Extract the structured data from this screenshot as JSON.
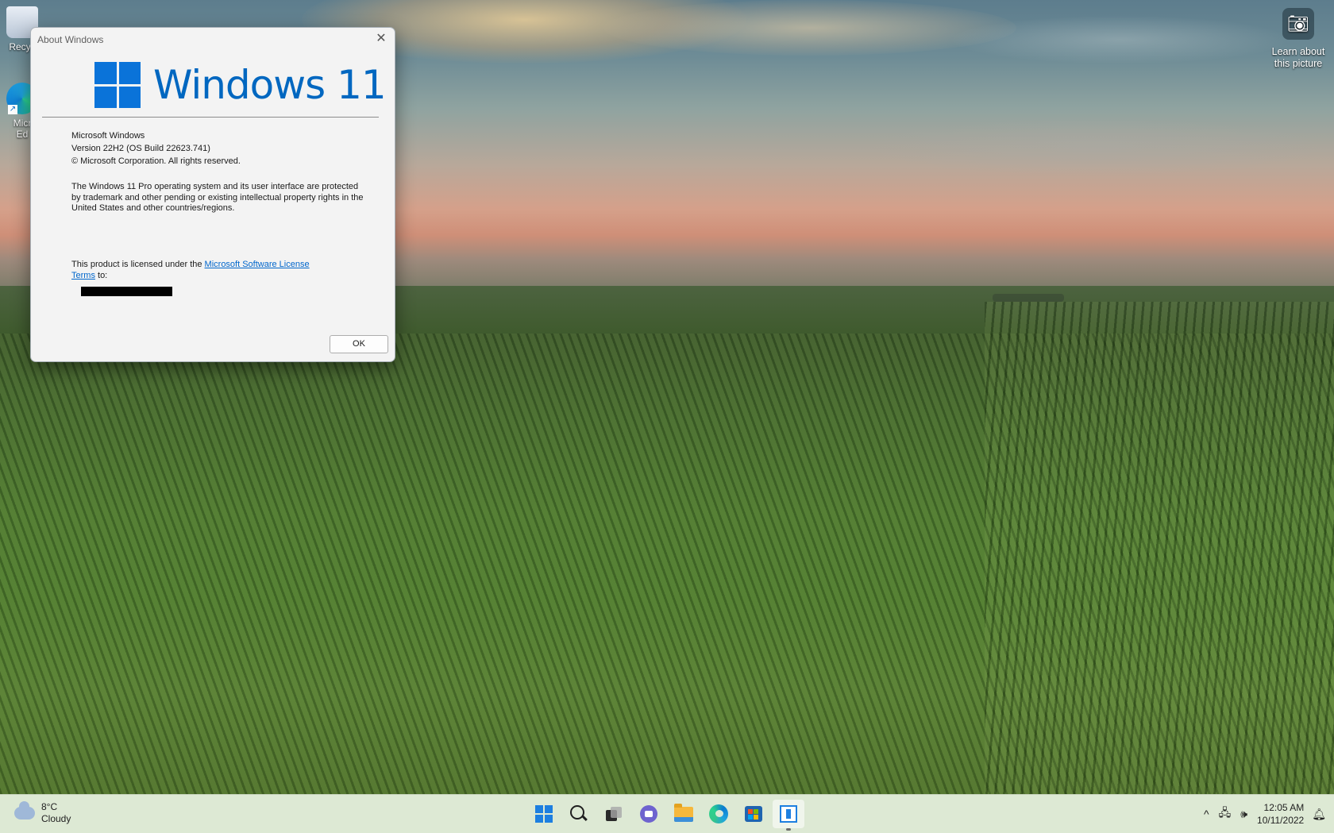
{
  "desktop": {
    "icons": [
      {
        "label": "Recycle Bin",
        "visible_label": "Recyc"
      },
      {
        "label": "Microsoft Edge",
        "visible_label_line1": "Micr",
        "visible_label_line2": "Ed"
      }
    ],
    "learn_about": {
      "icon": "camera-icon",
      "line1": "Learn about",
      "line2": "this picture"
    }
  },
  "dialog": {
    "title": "About Windows",
    "close_icon": "close-icon",
    "logo_text": "Windows 11",
    "product_name": "Microsoft Windows",
    "version": "Version 22H2 (OS Build 22623.741)",
    "copyright": "© Microsoft Corporation. All rights reserved.",
    "legal_text": "The Windows 11 Pro operating system and its user interface are protected by trademark and other pending or existing intellectual property rights in the United States and other countries/regions.",
    "license_prefix": "This product is licensed under the ",
    "license_link": "Microsoft Software License Terms",
    "license_suffix": " to:",
    "ok_label": "OK"
  },
  "taskbar": {
    "weather": {
      "icon": "cloud-icon",
      "temperature": "8°C",
      "condition": "Cloudy"
    },
    "pinned": [
      {
        "name": "start-button",
        "icon": "windows-logo-icon"
      },
      {
        "name": "search-button",
        "icon": "search-icon"
      },
      {
        "name": "task-view-button",
        "icon": "task-view-icon"
      },
      {
        "name": "chat-button",
        "icon": "chat-icon"
      },
      {
        "name": "file-explorer-button",
        "icon": "folder-icon"
      },
      {
        "name": "edge-button",
        "icon": "edge-icon"
      },
      {
        "name": "store-button",
        "icon": "store-icon"
      },
      {
        "name": "about-windows-button",
        "icon": "about-window-icon",
        "active": true
      }
    ],
    "tray": {
      "chevron": "^",
      "network_icon": "network-icon",
      "volume_icon": "volume-icon",
      "time": "12:05 AM",
      "date": "10/11/2022",
      "notification_icon": "bell-icon"
    }
  },
  "colors": {
    "accent": "#0067c0",
    "taskbar_bg": "#dde9d4",
    "dialog_bg": "#f3f3f3",
    "link": "#0066cc"
  }
}
